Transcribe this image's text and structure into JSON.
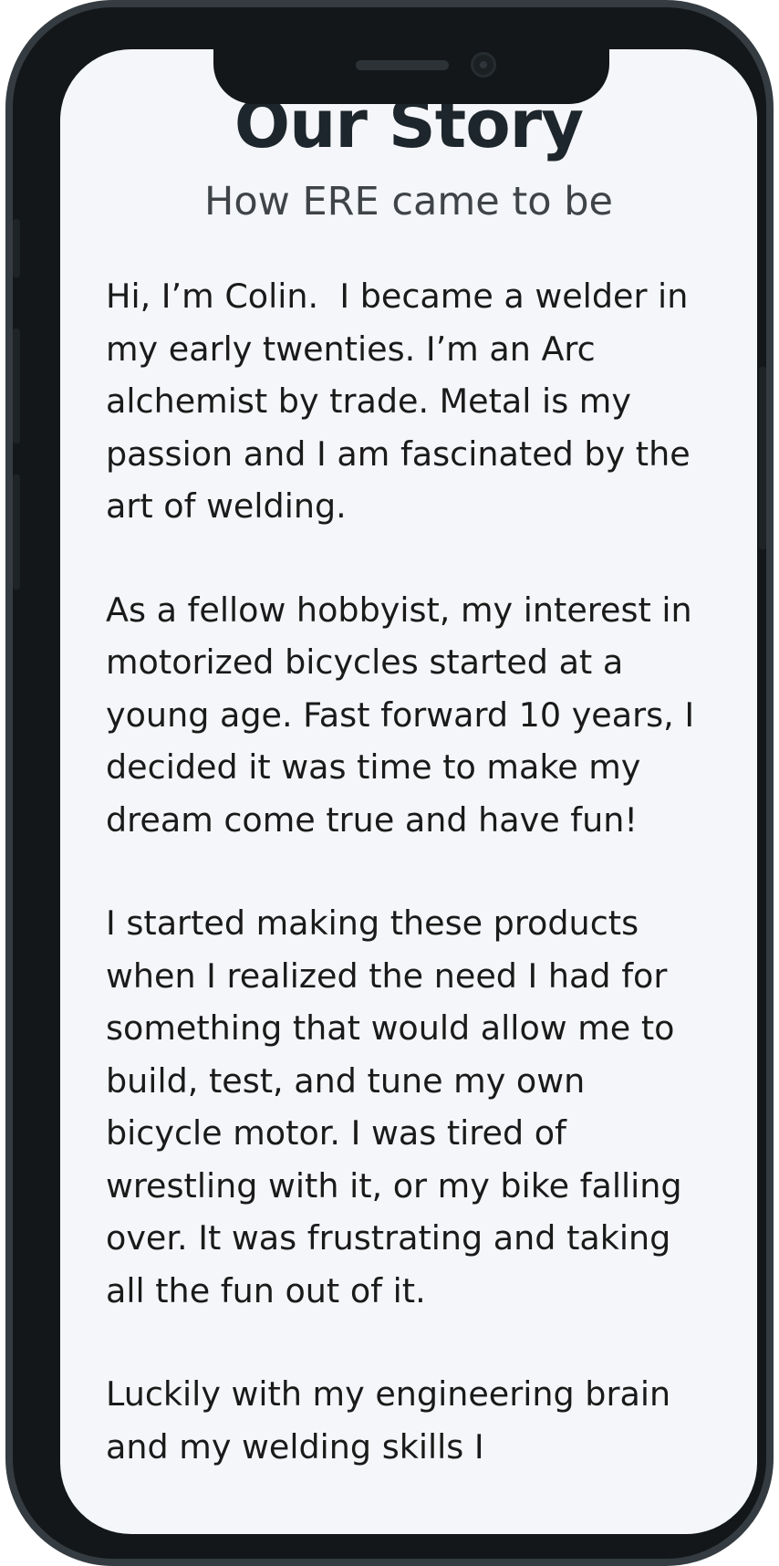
{
  "header": {
    "title": "Our Story",
    "subtitle": "How ERE came to be"
  },
  "story": {
    "paragraphs": [
      "Hi, I’m Colin.  I became a welder in my early twenties. I’m an Arc alchemist by trade. Metal is my passion and I am fascinated by the art of welding.",
      "As a fellow hobbyist, my interest in motorized bicycles started at a young age. Fast forward 10 years, I decided it was time to make my dream come true and have fun!",
      "I started making these products when I realized the need I had for something that would allow me to build, test, and tune my own bicycle motor. I was tired of wrestling with it, or my bike falling over. It was frustrating and taking all the fun out of it.",
      "Luckily with my engineering brain and my welding skills I"
    ]
  }
}
